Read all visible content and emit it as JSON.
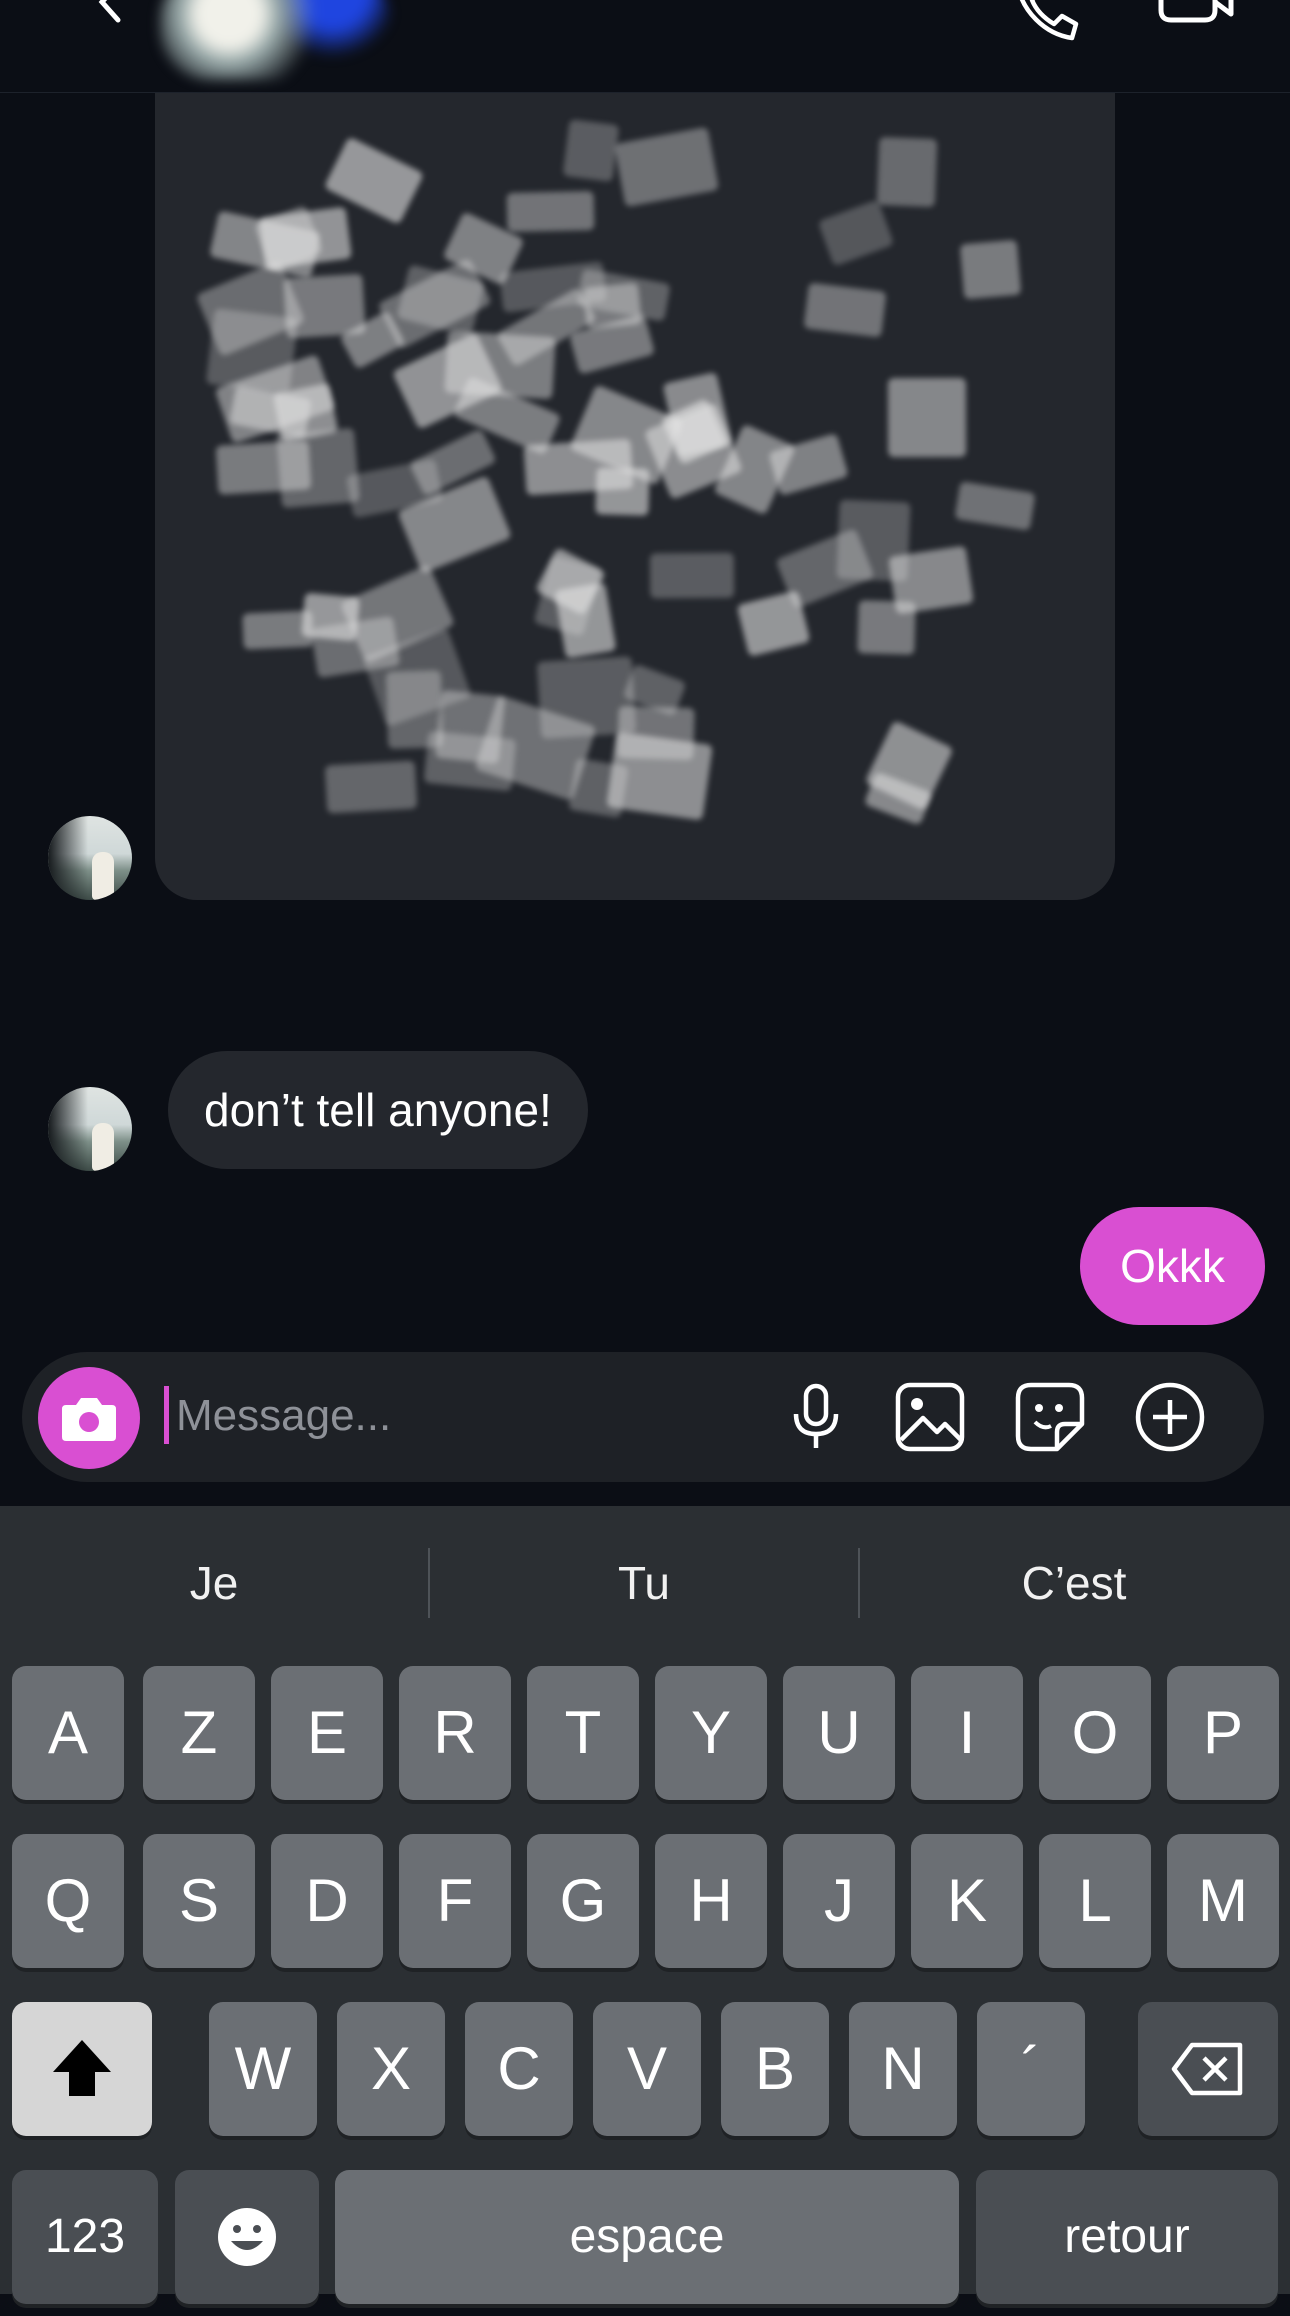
{
  "header": {
    "back_icon": "chevron-left-icon",
    "call_icon": "phone-icon",
    "video_icon": "video-camera-icon"
  },
  "messages": [
    {
      "type": "media",
      "from": "them",
      "content": "obscured image"
    },
    {
      "type": "text",
      "from": "them",
      "text": "don’t tell anyone!"
    },
    {
      "type": "text",
      "from": "me",
      "text": "Okkk"
    }
  ],
  "composer": {
    "placeholder": "Message...",
    "camera_icon": "camera-icon",
    "mic_icon": "microphone-icon",
    "gallery_icon": "image-icon",
    "sticker_icon": "sticker-icon",
    "plus_icon": "plus-circle-icon"
  },
  "keyboard": {
    "suggestions": [
      "Je",
      "Tu",
      "C’est"
    ],
    "row1": [
      "A",
      "Z",
      "E",
      "R",
      "T",
      "Y",
      "U",
      "I",
      "O",
      "P"
    ],
    "row2": [
      "Q",
      "S",
      "D",
      "F",
      "G",
      "H",
      "J",
      "K",
      "L",
      "M"
    ],
    "row3": [
      "W",
      "X",
      "C",
      "V",
      "B",
      "N",
      "´"
    ],
    "numbers_key": "123",
    "space_key": "espace",
    "return_key": "retour"
  },
  "colors": {
    "accent": "#d94fd2",
    "background": "#0b0e15",
    "bubble": "#24272d"
  }
}
